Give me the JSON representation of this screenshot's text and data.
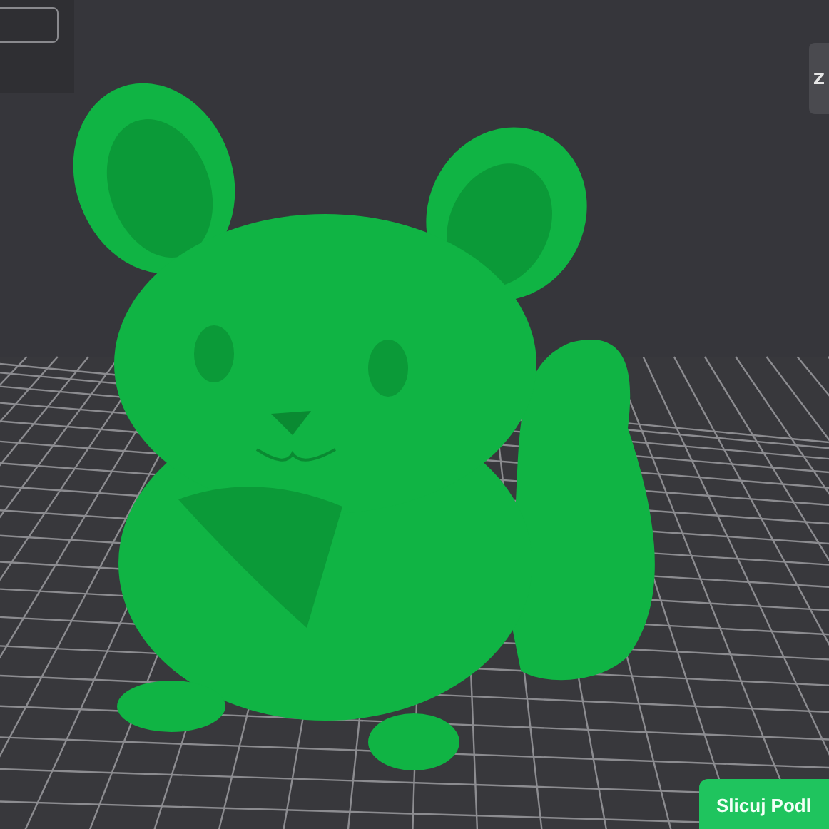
{
  "right_toolbar": {
    "button_label": "Z"
  },
  "slice_button": {
    "label": "Slicuj Podl"
  }
}
